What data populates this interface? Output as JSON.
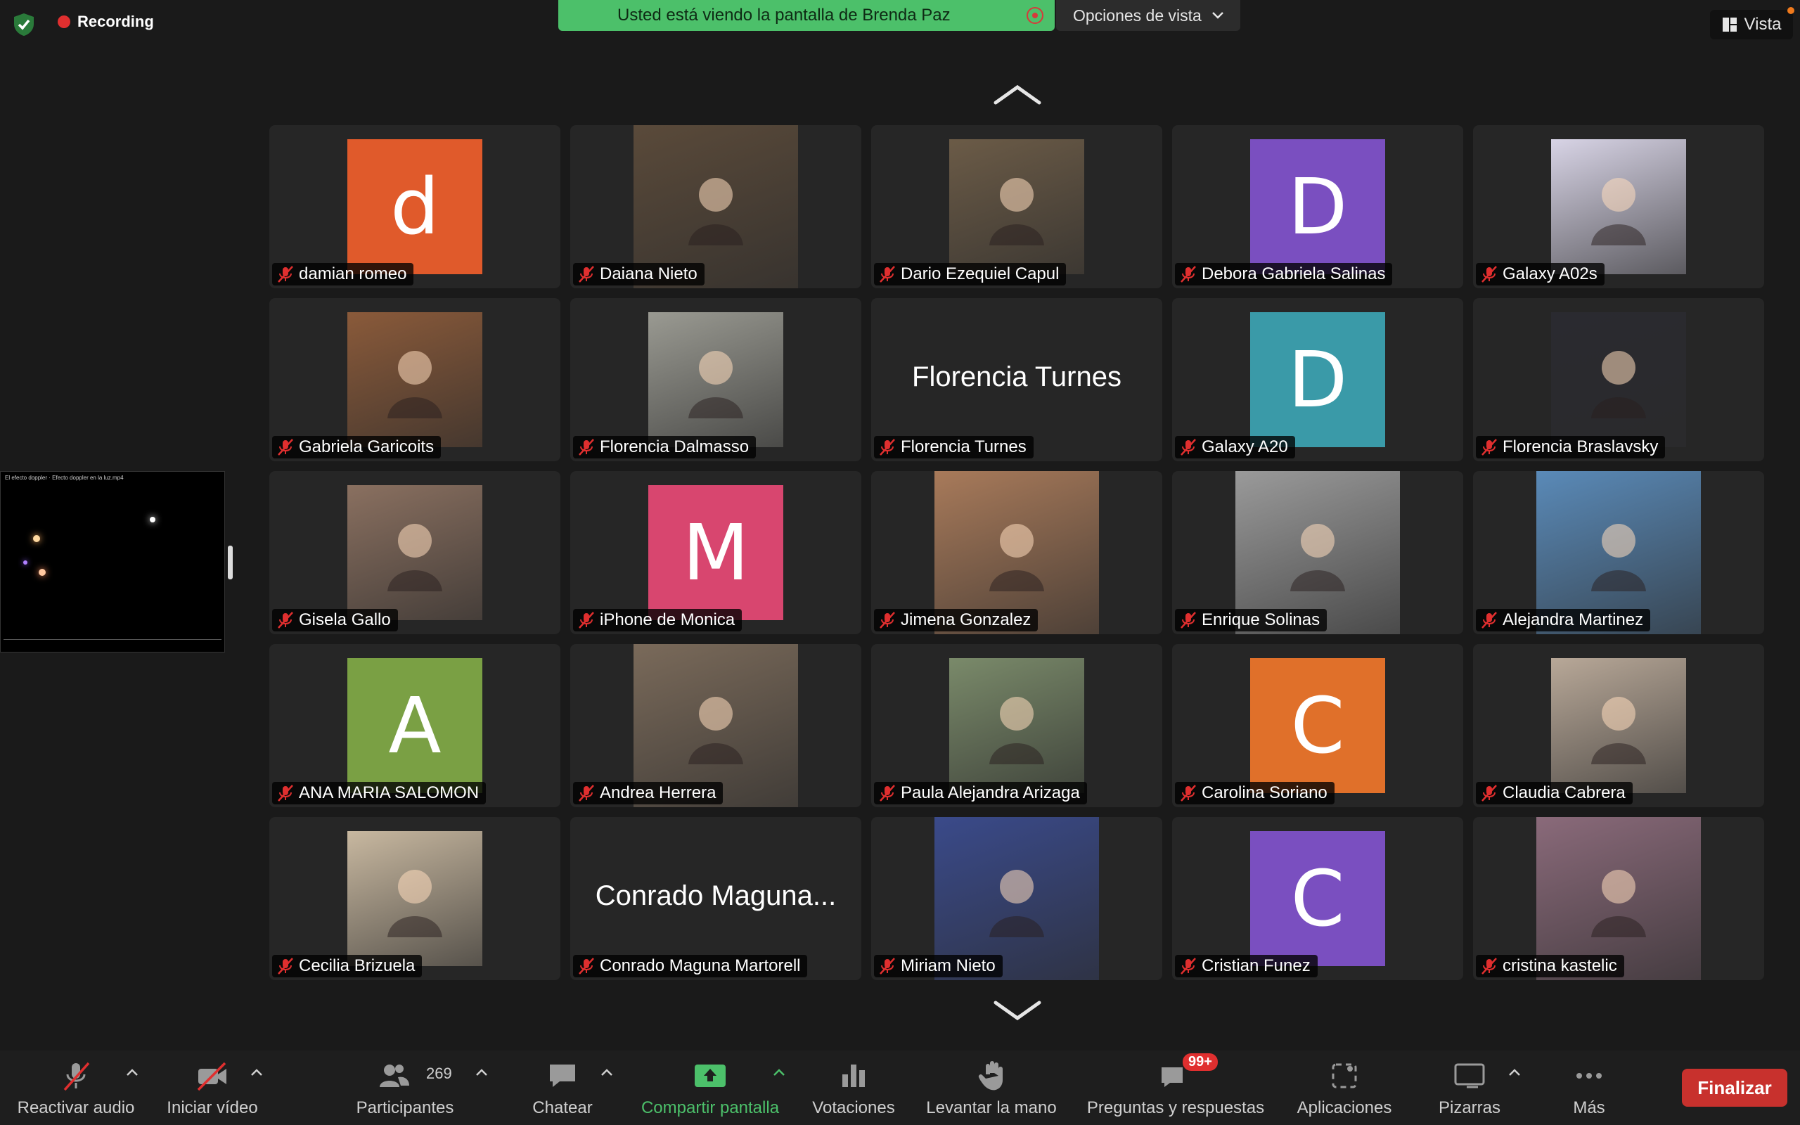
{
  "recording": {
    "label": "Recording"
  },
  "share_banner": {
    "text": "Usted está viendo la pantalla de Brenda Paz"
  },
  "view_options": {
    "label": "Opciones de vista"
  },
  "vista": {
    "label": "Vista"
  },
  "shared_thumbnail": {
    "caption": "El efecto doppler · Efecto doppler en la luz.mp4"
  },
  "participants": [
    {
      "name": "damian romeo",
      "letter": "d",
      "color": "#e05a2b",
      "type": "letter"
    },
    {
      "name": "Daiana Nieto",
      "type": "photo",
      "color": "#5a4a3a"
    },
    {
      "name": "Dario Ezequiel Capul",
      "type": "photo",
      "color": "#6b5b47"
    },
    {
      "name": "Debora Gabriela Salinas",
      "letter": "D",
      "color": "#7a4fc0",
      "type": "letter"
    },
    {
      "name": "Galaxy A02s",
      "type": "photo",
      "color": "#d8d4e6"
    },
    {
      "name": "Gabriela Garicoits",
      "type": "photo",
      "color": "#8a5a3a"
    },
    {
      "name": "Florencia Dalmasso",
      "type": "photo",
      "color": "#9a9a92"
    },
    {
      "name": "Florencia Turnes",
      "type": "text",
      "display": "Florencia Turnes"
    },
    {
      "name": "Galaxy A20",
      "letter": "D",
      "color": "#3a9aa8",
      "type": "letter"
    },
    {
      "name": "Florencia Braslavsky",
      "type": "photo",
      "color": "#2a2a30"
    },
    {
      "name": "Gisela Gallo",
      "type": "photo",
      "color": "#8a7060"
    },
    {
      "name": "iPhone de Monica",
      "letter": "M",
      "color": "#d8466f",
      "type": "letter"
    },
    {
      "name": "Jimena Gonzalez",
      "type": "photo",
      "color": "#a87a5a"
    },
    {
      "name": "Enrique Solinas",
      "type": "photo",
      "color": "#9a9a9a"
    },
    {
      "name": "Alejandra Martinez",
      "type": "photo",
      "color": "#5a8ab8"
    },
    {
      "name": "ANA MARIA SALOMON",
      "letter": "A",
      "color": "#7aa044",
      "type": "letter"
    },
    {
      "name": "Andrea Herrera",
      "type": "photo",
      "color": "#7a6a5a"
    },
    {
      "name": "Paula Alejandra Arizaga",
      "type": "photo",
      "color": "#7a8a6a"
    },
    {
      "name": "Carolina Soriano",
      "letter": "C",
      "color": "#e0702a",
      "type": "letter"
    },
    {
      "name": "Claudia Cabrera",
      "type": "photo",
      "color": "#b8a898"
    },
    {
      "name": "Cecilia Brizuela",
      "type": "photo",
      "color": "#c8b8a0"
    },
    {
      "name": "Conrado Maguna Martorell",
      "type": "text",
      "display": "Conrado Maguna..."
    },
    {
      "name": "Miriam Nieto",
      "type": "photo",
      "color": "#3a4a8a"
    },
    {
      "name": "Cristian Funez",
      "letter": "C",
      "color": "#7a4fc0",
      "type": "letter"
    },
    {
      "name": "cristina kastelic",
      "type": "photo",
      "color": "#8a6a7a"
    }
  ],
  "toolbar": {
    "audio": "Reactivar audio",
    "video": "Iniciar vídeo",
    "participants": "Participantes",
    "participants_count": "269",
    "chat": "Chatear",
    "share": "Compartir pantalla",
    "polls": "Votaciones",
    "raise_hand": "Levantar la mano",
    "qa": "Preguntas y respuestas",
    "qa_badge": "99+",
    "apps": "Aplicaciones",
    "whiteboards": "Pizarras",
    "more": "Más",
    "end": "Finalizar"
  },
  "colors": {
    "share_green": "#4cc06a",
    "end_red": "#c8312d",
    "tile_bg": "#262626"
  }
}
